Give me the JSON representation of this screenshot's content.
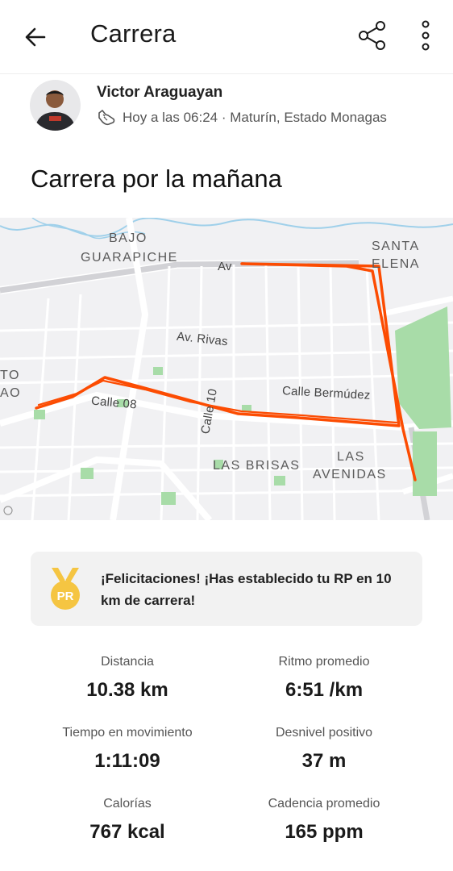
{
  "header": {
    "title": "Carrera",
    "back_icon": "arrow-left-icon",
    "share_icon": "share-icon",
    "more_icon": "more-vertical-icon"
  },
  "athlete": {
    "name": "Victor Araguayan",
    "meta": "Hoy a las 06:24 · Maturín, Estado Monagas",
    "activity_icon": "running-shoe-icon"
  },
  "activity": {
    "title": "Carrera por la mañana"
  },
  "map": {
    "labels": {
      "bajo": "BAJO",
      "guarapiche": "GUARAPICHE",
      "santa": "SANTA",
      "elena": "ELENA",
      "av_partial": "Av",
      "av_rivas": "Av. Rivas",
      "calle_bermudez": "Calle Bermúdez",
      "calle_08": "Calle 08",
      "calle_10": "Calle 10",
      "to": "TO",
      "ao": "AO",
      "las_brisas": "LAS BRISAS",
      "las": "LAS",
      "avenidas": "AVENIDAS"
    },
    "route_color": "#fc4c02"
  },
  "achievement": {
    "text": "¡Felicitaciones! ¡Has establecido tu RP en 10 km de carrera!",
    "badge": "PR",
    "icon": "medal-icon",
    "color": "#f5c542"
  },
  "stats": [
    {
      "label": "Distancia",
      "value": "10.38 km"
    },
    {
      "label": "Ritmo promedio",
      "value": "6:51 /km"
    },
    {
      "label": "Tiempo en movimiento",
      "value": "1:11:09"
    },
    {
      "label": "Desnivel positivo",
      "value": "37 m"
    },
    {
      "label": "Calorías",
      "value": "767 kcal"
    },
    {
      "label": "Cadencia promedio",
      "value": "165 ppm"
    }
  ]
}
